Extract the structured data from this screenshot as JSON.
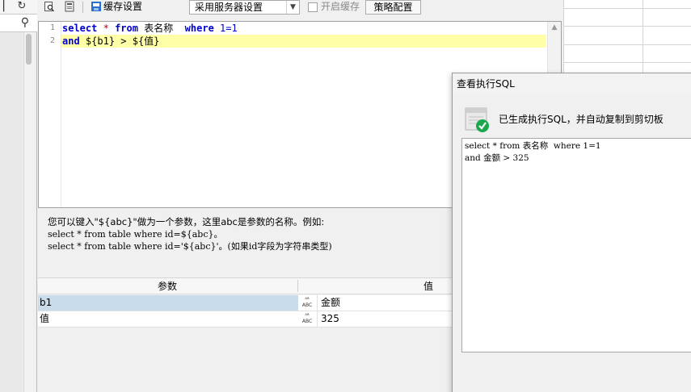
{
  "toolbar": {
    "cache_label": "缓存设置",
    "cache_mode_value": "采用服务器设置",
    "enable_cache_label": "开启缓存",
    "strategy_button": "策略配置"
  },
  "editor": {
    "line_numbers": [
      "1",
      "2"
    ],
    "line1": {
      "select": "select",
      "star": "*",
      "from": "from",
      "table": "表名称",
      "where": "where",
      "cond": "1=1"
    },
    "line2": {
      "and": "and",
      "rest": "${b1} > ${值}"
    }
  },
  "help": {
    "line1": "您可以键入\"${abc}\"做为一个参数，这里abc是参数的名称。例如:",
    "line2": "select * from table where id=${abc}。",
    "line3": "select * from table where id='${abc}'。(如果id字段为字符串类型)"
  },
  "params": {
    "header_param": "参数",
    "header_value": "值",
    "type_glyph_top": "ᴬᴮ",
    "type_glyph_bottom": "ABC",
    "rows": [
      {
        "name": "b1",
        "value": "金额"
      },
      {
        "name": "值",
        "value": "325"
      }
    ]
  },
  "dialog": {
    "title": "查看执行SQL",
    "message": "已生成执行SQL，并自动复制到剪切板",
    "sql_line1": "select * from 表名称  where 1=1",
    "sql_line2": "and 金额 > 325"
  },
  "colors": {
    "keyword": "#0000cc",
    "operator": "#c00000",
    "highlight_line": "#ffffa8",
    "selected_row": "#c9dcec",
    "success_check": "#1aa84a"
  }
}
